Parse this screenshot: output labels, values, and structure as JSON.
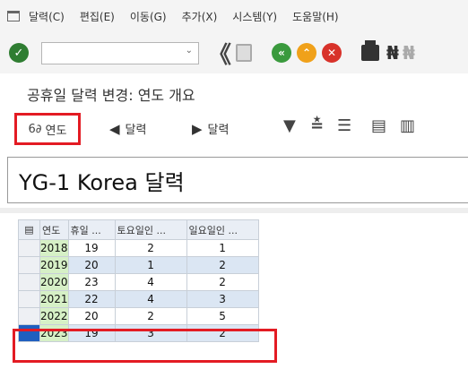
{
  "menu": {
    "items": [
      "달력(C)",
      "편집(E)",
      "이동(G)",
      "추가(X)",
      "시스템(Y)",
      "도움말(H)"
    ]
  },
  "toolbar": {
    "command_value": "",
    "icons": [
      "check-icon",
      "dropdown-icon",
      "back-double-icon",
      "save-icon",
      "back-icon",
      "exit-icon",
      "cancel-icon",
      "print-icon",
      "find-icon",
      "find-next-icon"
    ]
  },
  "screen": {
    "title": "공휴일 달력 변경: 연도 개요"
  },
  "app_toolbar": {
    "year_button": "연도",
    "prev_calendar": "달력",
    "next_calendar": "달력"
  },
  "header": {
    "calendar_name": "YG-1 Korea 달력"
  },
  "grid": {
    "columns": [
      "연도",
      "휴일 ...",
      "토요일인 ...",
      "일요일인 ..."
    ],
    "rows": [
      {
        "year": "2018",
        "holidays": "19",
        "saturday": "2",
        "sunday": "1"
      },
      {
        "year": "2019",
        "holidays": "20",
        "saturday": "1",
        "sunday": "2"
      },
      {
        "year": "2020",
        "holidays": "23",
        "saturday": "4",
        "sunday": "2"
      },
      {
        "year": "2021",
        "holidays": "22",
        "saturday": "4",
        "sunday": "3"
      },
      {
        "year": "2022",
        "holidays": "20",
        "saturday": "2",
        "sunday": "5"
      },
      {
        "year": "2023",
        "holidays": "19",
        "saturday": "3",
        "sunday": "2"
      }
    ]
  },
  "colors": {
    "highlight": "#e31b23",
    "year_cell": "#d6f0c6",
    "row_alt": "#dbe6f3",
    "selected_marker": "#1f5fbf"
  }
}
